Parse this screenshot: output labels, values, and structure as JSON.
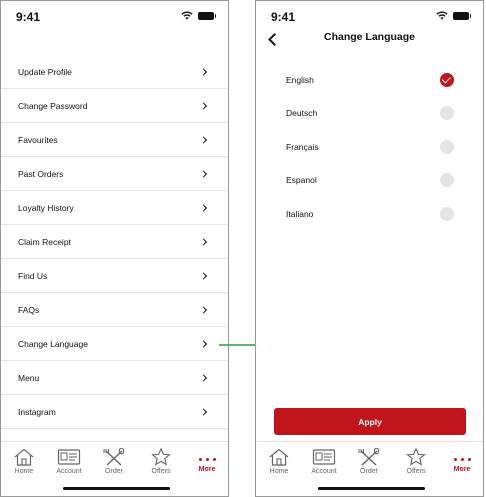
{
  "colors": {
    "accent": "#c0161b",
    "arrow": "#2e9a3a"
  },
  "left": {
    "status_time": "9:41",
    "menu_items": [
      {
        "label": "Update Profile"
      },
      {
        "label": "Change Password"
      },
      {
        "label": "Favourites"
      },
      {
        "label": "Past Orders"
      },
      {
        "label": "Loyalty History"
      },
      {
        "label": "Claim Receipt"
      },
      {
        "label": "Find Us"
      },
      {
        "label": "FAQs"
      },
      {
        "label": "Change Language"
      },
      {
        "label": "Menu"
      },
      {
        "label": "Instagram"
      }
    ]
  },
  "right": {
    "status_time": "9:41",
    "title": "Change Language",
    "languages": [
      {
        "label": "English",
        "selected": true
      },
      {
        "label": "Deutsch",
        "selected": false
      },
      {
        "label": "Français",
        "selected": false
      },
      {
        "label": "Espanol",
        "selected": false
      },
      {
        "label": "Italiano",
        "selected": false
      }
    ],
    "apply_label": "Apply"
  },
  "tabs": [
    {
      "label": "Home",
      "icon": "house-icon",
      "active": false
    },
    {
      "label": "Account",
      "icon": "id-card-icon",
      "active": false
    },
    {
      "label": "Order",
      "icon": "fork-spoon-icon",
      "active": false
    },
    {
      "label": "Offers",
      "icon": "star-icon",
      "active": false
    },
    {
      "label": "More",
      "icon": "more-dots-icon",
      "active": true
    }
  ]
}
